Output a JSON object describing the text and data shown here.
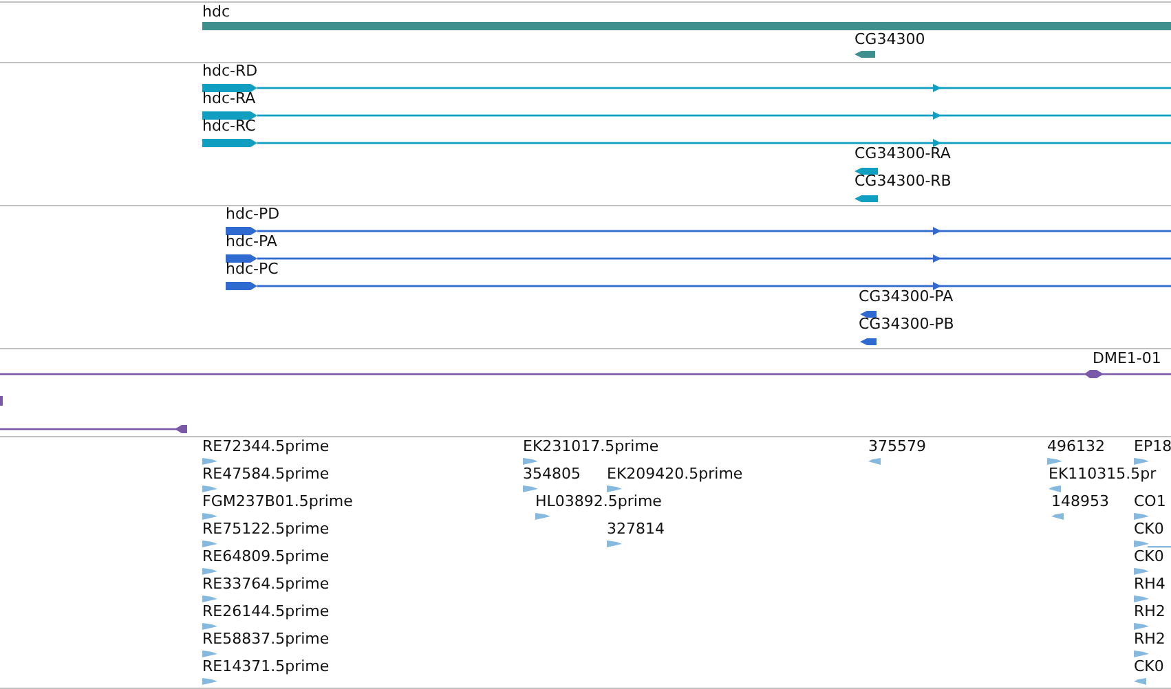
{
  "tracks": [
    {
      "kind": "gene",
      "color": "#3f8f8f",
      "features": [
        {
          "label": "hdc",
          "reverse": false
        },
        {
          "label": "CG34300",
          "reverse": true
        }
      ]
    },
    {
      "kind": "mrna",
      "color": "#109fc0",
      "features": [
        {
          "label": "hdc-RD",
          "reverse": false
        },
        {
          "label": "hdc-RA",
          "reverse": false
        },
        {
          "label": "hdc-RC",
          "reverse": false
        },
        {
          "label": "CG34300-RA",
          "reverse": true
        },
        {
          "label": "CG34300-RB",
          "reverse": true
        }
      ]
    },
    {
      "kind": "cds",
      "color": "#2f6ad0",
      "features": [
        {
          "label": "hdc-PD",
          "reverse": false
        },
        {
          "label": "hdc-PA",
          "reverse": false
        },
        {
          "label": "hdc-PC",
          "reverse": false
        },
        {
          "label": "CG34300-PA",
          "reverse": true
        },
        {
          "label": "CG34300-PB",
          "reverse": true
        }
      ]
    },
    {
      "kind": "match",
      "color": "#7a5aa8",
      "features": [
        {
          "label": "DME1-01",
          "reverse": false
        },
        {
          "reverse": true
        }
      ]
    },
    {
      "kind": "est",
      "color": "#86b9de",
      "features": [
        {
          "label": "RE72344.5prime",
          "reverse": false
        },
        {
          "label": "EK231017.5prime",
          "reverse": false
        },
        {
          "label": "375579",
          "reverse": true
        },
        {
          "label": "496132",
          "reverse": false
        },
        {
          "label": "EP18",
          "reverse": false
        },
        {
          "label": "RE47584.5prime",
          "reverse": false
        },
        {
          "label": "354805",
          "reverse": false
        },
        {
          "label": "EK209420.5prime",
          "reverse": false
        },
        {
          "label": "EK110315.5pr",
          "reverse": true
        },
        {
          "label": "FGM237B01.5prime",
          "reverse": false
        },
        {
          "label": "HL03892.5prime",
          "reverse": false
        },
        {
          "label": "148953",
          "reverse": true
        },
        {
          "label": "CO1",
          "reverse": false
        },
        {
          "label": "RE75122.5prime",
          "reverse": false
        },
        {
          "label": "327814",
          "reverse": false
        },
        {
          "label": "CK0",
          "reverse": false
        },
        {
          "label": "RE64809.5prime",
          "reverse": false
        },
        {
          "label": "CK0",
          "reverse": false
        },
        {
          "label": "RE33764.5prime",
          "reverse": false
        },
        {
          "label": "RH4",
          "reverse": false
        },
        {
          "label": "RE26144.5prime",
          "reverse": false
        },
        {
          "label": "RH2",
          "reverse": false
        },
        {
          "label": "RE58837.5prime",
          "reverse": false
        },
        {
          "label": "RH2",
          "reverse": false
        },
        {
          "label": "RE14371.5prime",
          "reverse": false
        },
        {
          "label": "CK0",
          "reverse": true
        }
      ]
    }
  ]
}
